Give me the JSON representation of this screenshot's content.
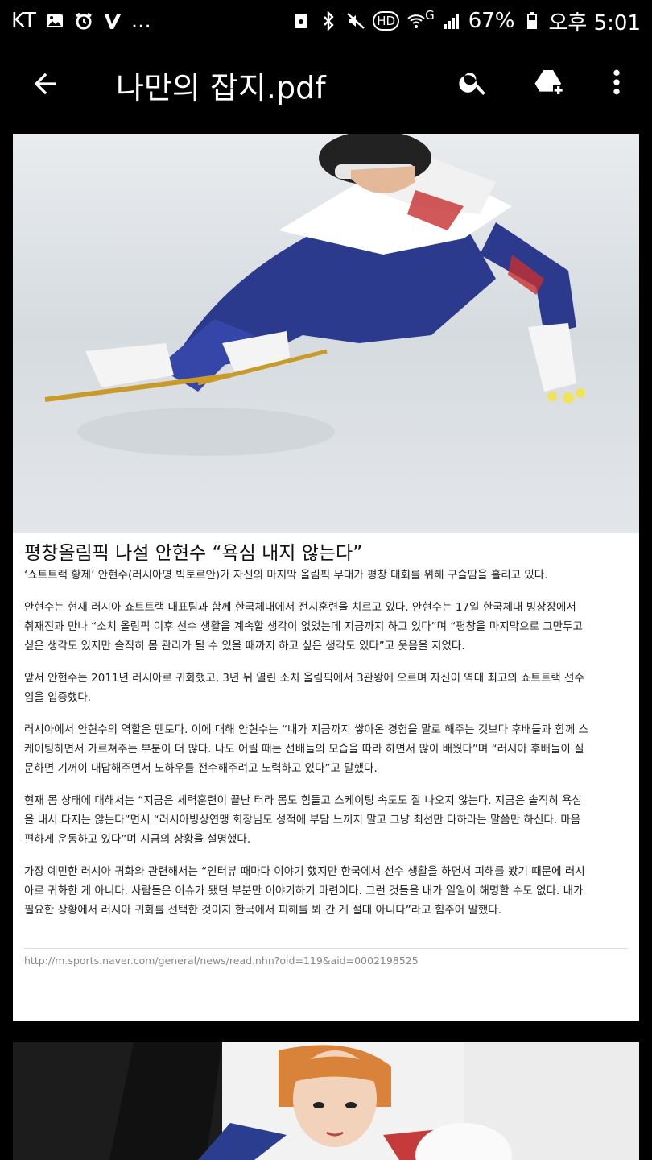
{
  "status_bar": {
    "carrier": "KT",
    "more": "...",
    "hd": "HD",
    "net": "G",
    "battery": "67%",
    "time": "오후 5:01"
  },
  "app_bar": {
    "title": "나만의 잡지.pdf",
    "icons": [
      "back-arrow-icon",
      "search-icon",
      "drive-add-icon",
      "more-vert-icon"
    ]
  },
  "article": {
    "headline": "평창올림픽 나설 안현수 “욕심 내지 않는다”",
    "subheadline": "‘쇼트트랙 황제’ 안현수(러시아명 빅토르안)가 자신의 마지막 올림픽 무대가 평창 대회를 위해 구슬땀을 흘리고 있다.",
    "paragraphs": [
      "안현수는 현재 러시아 쇼트트랙 대표팀과 함께 한국체대에서 전지훈련을 치르고 있다. 안현수는 17일 한국체대 빙상장에서\n취재진과 만나 “소치 올림픽 이후 선수 생활을 계속할 생각이 없었는데 지금까지 하고 있다”며 “평창을 마지막으로 그만두고\n싶은 생각도 있지만 솔직히 몸 관리가 될 수 있을 때까지 하고 싶은 생각도 있다”고 웃음을 지었다.",
      "앞서 안현수는 2011년 러시아로 귀화했고, 3년 뒤 열린 소치 올림픽에서 3관왕에 오르며 자신이 역대 최고의 쇼트트랙 선수\n임을 입증했다.",
      "러시아에서 안현수의 역할은 멘토다. 이에 대해 안현수는 “내가 지금까지 쌓아온 경험을 말로 해주는 것보다 후배들과 함께 스\n케이팅하면서 가르쳐주는 부분이 더 많다. 나도 어릴 때는 선배들의 모습을 따라 하면서 많이 배웠다”며 “러시아 후배들이 질\n문하면 기꺼이 대답해주면서 노하우를 전수해주려고 노력하고 있다”고 말했다.",
      "현재 몸 상태에 대해서는 “지금은 체력훈련이 끝난 터라 몸도 힘들고 스케이팅 속도도 잘 나오지 않는다. 지금은 솔직히 욕심\n을 내서 타지는 않는다”면서 “러시아빙상연맹 회장님도 성적에 부담 느끼지 말고 그냥 최선만 다하라는 말씀만 하신다. 마음\n편하게 운동하고 있다”며 지금의 상황을 설명했다.",
      "가장 예민한 러시아 귀화와 관련해서는 “인터뷰 때마다 이야기 했지만 한국에서 선수 생활을 하면서 피해를 봤기 때문에 러시\n아로 귀화한 게 아니다. 사람들은 이슈가 됐던 부분만 이야기하기 마련이다. 그런 것들을 내가 일일이 해명할 수도 없다. 내가\n필요한 상황에서 러시아 귀화를 선택한 것이지 한국에서 피해를 봐 간 게 절대 아니다”라고 힘주어 말했다."
    ],
    "source_url": "http://m.sports.naver.com/general/news/read.nhn?oid=119&aid=0002198525"
  },
  "colors": {
    "background": "#000000",
    "page": "#ffffff",
    "text": "#222222",
    "source_text": "#888888"
  }
}
